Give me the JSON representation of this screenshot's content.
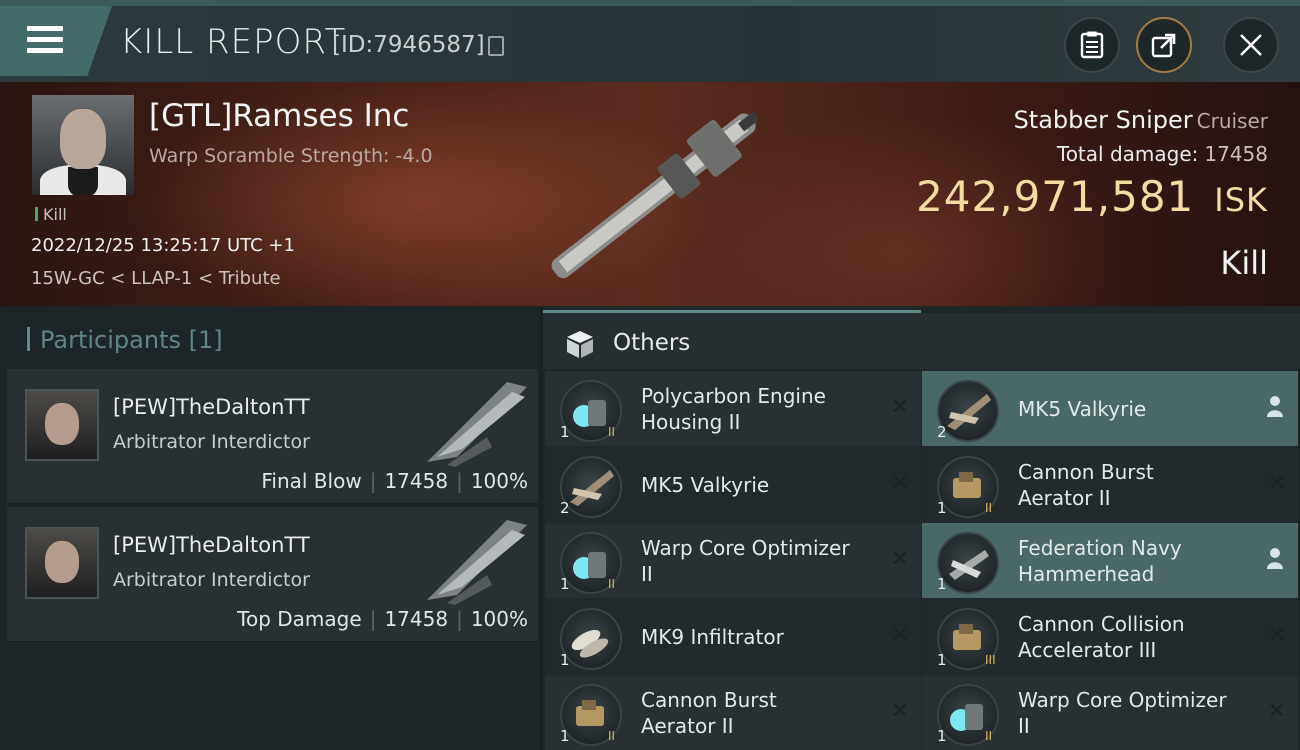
{
  "header": {
    "title": "KILL REPORT",
    "id_label": "[ID:7946587]",
    "menu_icon": "hamburger-menu-icon",
    "buttons": [
      "clipboard-icon",
      "share-icon",
      "close-icon"
    ]
  },
  "victim": {
    "name": "[GTL]Ramses Inc",
    "scramble": "Warp Soramble Strength: -4.0",
    "kill_tag": "Kill",
    "datetime": "2022/12/25 13:25:17 UTC +1",
    "location": "15W-GC < LLAP-1 < Tribute",
    "ship_name": "Stabber Sniper",
    "ship_class": "Cruiser",
    "total_damage_label": "Total damage:",
    "total_damage": "17458",
    "isk_value": "242,971,581",
    "isk_unit": "ISK",
    "result": "Kill"
  },
  "participants": {
    "label": "Participants",
    "count": "[1]",
    "rows": [
      {
        "name": "[PEW]TheDaltonTT",
        "ship": "Arbitrator Interdictor",
        "role": "Final Blow",
        "damage": "17458",
        "percent": "100%"
      },
      {
        "name": "[PEW]TheDaltonTT",
        "ship": "Arbitrator Interdictor",
        "role": "Top Damage",
        "damage": "17458",
        "percent": "100%"
      }
    ]
  },
  "others": {
    "label": "Others",
    "left": [
      {
        "name1": "Polycarbon Engine",
        "name2": "Housing II",
        "qty": "1",
        "meta": "II"
      },
      {
        "name1": "MK5  Valkyrie",
        "name2": "",
        "qty": "2",
        "meta": ""
      },
      {
        "name1": "Warp Core Optimizer",
        "name2": "II",
        "qty": "1",
        "meta": "II"
      },
      {
        "name1": "MK9  Infiltrator",
        "name2": "",
        "qty": "1",
        "meta": ""
      },
      {
        "name1": "Cannon Burst",
        "name2": "Aerator II",
        "qty": "1",
        "meta": "II"
      }
    ],
    "right": [
      {
        "name1": "MK5  Valkyrie",
        "name2": "",
        "qty": "2",
        "meta": ""
      },
      {
        "name1": "Cannon Burst",
        "name2": "Aerator II",
        "qty": "1",
        "meta": "II"
      },
      {
        "name1": "Federation Navy",
        "name2": "Hammerhead",
        "qty": "1",
        "meta": ""
      },
      {
        "name1": "Cannon Collision",
        "name2": "Accelerator III",
        "qty": "1",
        "meta": "III"
      },
      {
        "name1": "Warp Core Optimizer",
        "name2": "II",
        "qty": "1",
        "meta": "II"
      }
    ],
    "close_glyph": "✕"
  }
}
